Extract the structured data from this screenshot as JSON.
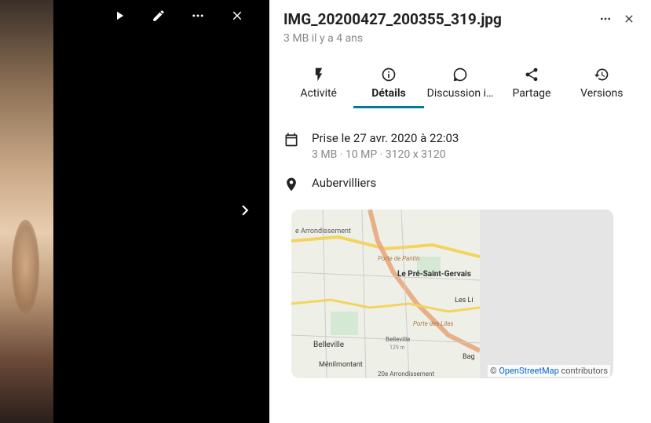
{
  "viewer": {
    "play_icon": "play",
    "edit_icon": "edit",
    "more_icon": "more",
    "close_icon": "close",
    "next_icon": "next"
  },
  "panel": {
    "title": "IMG_20200427_200355_319.jpg",
    "subtitle": "3 MB il y a 4 ans",
    "more_icon": "more",
    "close_icon": "close"
  },
  "tabs": {
    "items": [
      {
        "label": "Activité",
        "icon": "bolt"
      },
      {
        "label": "Détails",
        "icon": "info"
      },
      {
        "label": "Discussion i…",
        "icon": "chat"
      },
      {
        "label": "Partage",
        "icon": "share"
      },
      {
        "label": "Versions",
        "icon": "history"
      }
    ],
    "active_index": 1
  },
  "details": {
    "capture": {
      "primary": "Prise le 27 avr. 2020 à 22:03",
      "secondary": "3 MB · 10 MP · 3120 x 3120"
    },
    "location": {
      "name": "Aubervilliers"
    }
  },
  "map": {
    "labels": {
      "arrondissement_top": "e Arrondissement",
      "porte_pantin": "Porte de Pantin",
      "pre_saint_gervais": "Le Pré-Saint-Gervais",
      "les_li": "Les Li",
      "porte_lilas": "Porte des Lilas",
      "belleville_station": "Belleville",
      "belleville_alt": "129 m",
      "belleville": "Belleville",
      "menilmontant": "Ménilmontant",
      "bag": "Bag",
      "arrondissement_bottom": "20e Arrondissement"
    },
    "attribution_prefix": "© ",
    "attribution_link": "OpenStreetMap",
    "attribution_suffix": " contributors"
  }
}
